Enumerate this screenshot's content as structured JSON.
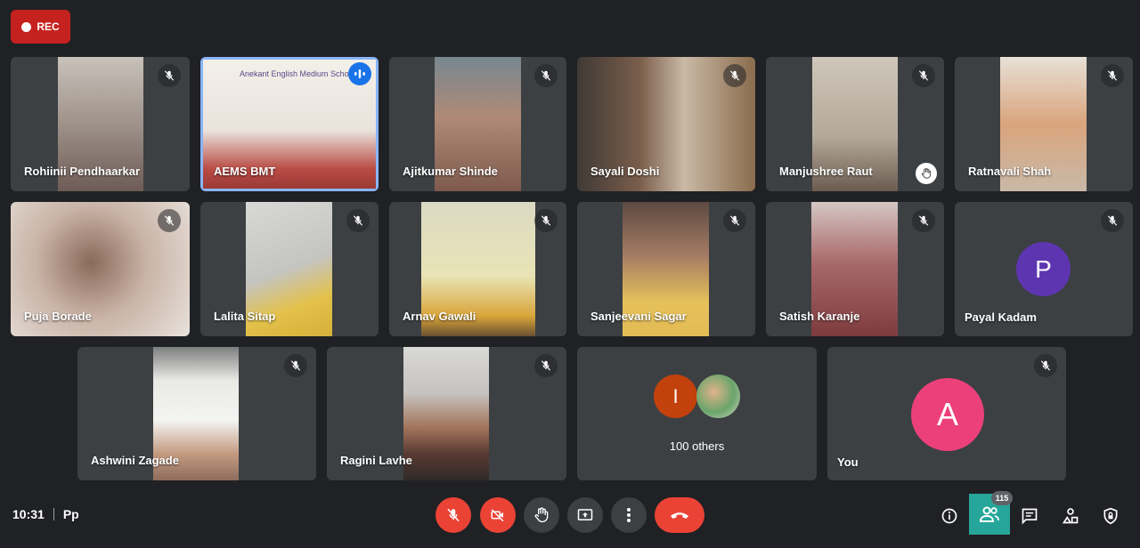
{
  "recording": {
    "label": "REC"
  },
  "participants": [
    {
      "name": "Rohiinii Pendhaarkar",
      "muted": true
    },
    {
      "name": "AEMS BMT",
      "muted": false,
      "speaking": true
    },
    {
      "name": "Ajitkumar Shinde",
      "muted": true
    },
    {
      "name": "Sayali Doshi",
      "muted": true
    },
    {
      "name": "Manjushree Raut",
      "muted": true,
      "hand_raised": true
    },
    {
      "name": "Ratnavali Shah",
      "muted": true
    },
    {
      "name": "Puja Borade",
      "muted": true
    },
    {
      "name": "Lalita Sitap",
      "muted": true
    },
    {
      "name": "Arnav Gawali",
      "muted": true
    },
    {
      "name": "Sanjeevani Sagar",
      "muted": true
    },
    {
      "name": "Satish Karanje",
      "muted": true
    },
    {
      "name": "Payal Kadam",
      "muted": true,
      "avatar_letter": "P",
      "avatar_color": "#5e35b1"
    },
    {
      "name": "Ashwini Zagade",
      "muted": true
    },
    {
      "name": "Ragini Lavhe",
      "muted": true
    }
  ],
  "others_tile": {
    "label": "100 others",
    "avatar_letter": "I",
    "avatar_color": "#c2410c"
  },
  "self_tile": {
    "name": "You",
    "avatar_letter": "A",
    "avatar_color": "#ec407a",
    "muted": true
  },
  "speaker_card": {
    "text": "Anekant English Medium School"
  },
  "bottom_bar": {
    "time": "10:31",
    "meeting_code": "Pp",
    "people_count": "115"
  },
  "colors": {
    "background": "#202124",
    "tile": "#3c4043",
    "danger": "#ea4335",
    "accent": "#8ab4f8"
  }
}
